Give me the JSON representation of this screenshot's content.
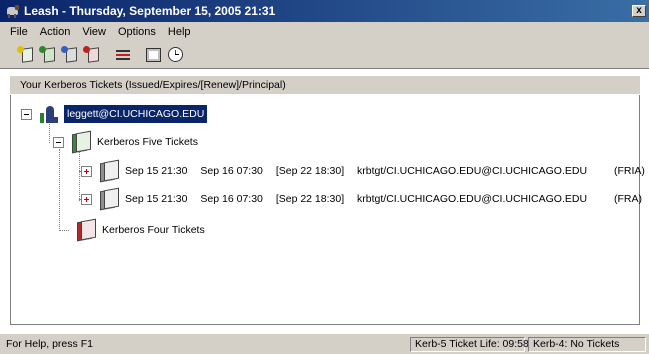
{
  "window": {
    "title": "Leash - Thursday, September 15, 2005  21:31",
    "close_glyph": "x"
  },
  "menu": [
    "File",
    "Action",
    "View",
    "Options",
    "Help"
  ],
  "toolbar": {
    "icons": [
      "get-ticket-icon",
      "renew-ticket-icon",
      "import-ticket-icon",
      "destroy-ticket-icon",
      "change-password-icon",
      "sync-time-icon",
      "properties-icon",
      "debug-window-icon",
      "clock-icon"
    ]
  },
  "panel": {
    "header": "Your Kerberos Tickets (Issued/Expires/[Renew]/Principal)"
  },
  "tree": {
    "principal": "leggett@CI.UCHICAGO.EDU",
    "krb5_label": "Kerberos Five Tickets",
    "krb4_label": "Kerberos Four Tickets",
    "tickets": [
      {
        "issued": "Sep 15 21:30",
        "expires": "Sep 16 07:30",
        "renew": "[Sep 22 18:30]",
        "principal": "krbtgt/CI.UCHICAGO.EDU@CI.UCHICAGO.EDU",
        "flags": "(FRIA)"
      },
      {
        "issued": "Sep 15 21:30",
        "expires": "Sep 16 07:30",
        "renew": "[Sep 22 18:30]",
        "principal": "krbtgt/CI.UCHICAGO.EDU@CI.UCHICAGO.EDU",
        "flags": "(FRA)"
      }
    ]
  },
  "status": {
    "help": "For Help, press F1",
    "krb5_life": "Kerb-5 Ticket Life: 09:58",
    "krb4": "Kerb-4: No Tickets"
  },
  "colors": {
    "titlebar": "#0a246a",
    "chrome": "#d4d0c8",
    "selection": "#0a246a"
  }
}
